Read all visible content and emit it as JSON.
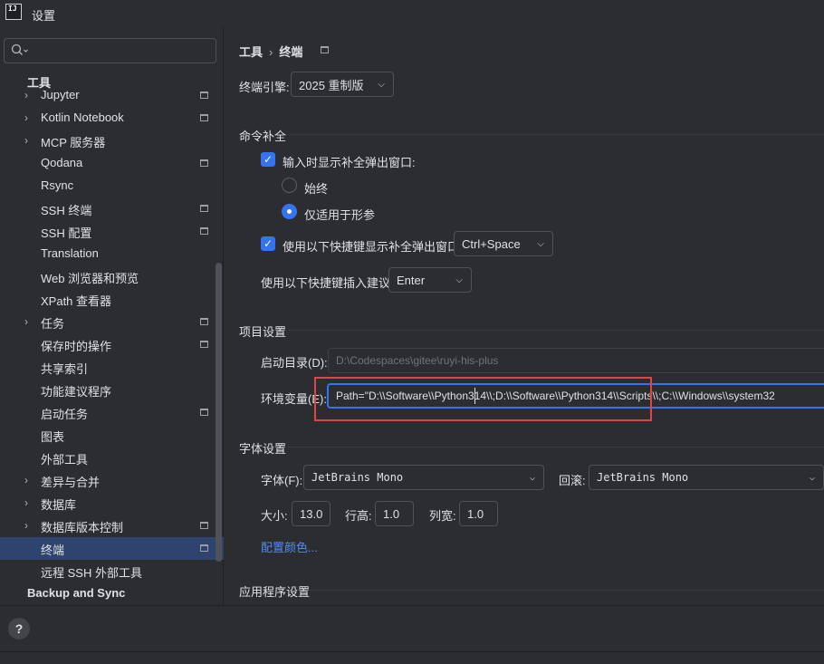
{
  "window": {
    "app_icon": "IJ",
    "title": "设置"
  },
  "search": {
    "value": "",
    "icon": "search-icon"
  },
  "sidebar": {
    "section_title": "工具",
    "items": [
      {
        "label": "Jupyter",
        "chevron": true,
        "doc": true
      },
      {
        "label": "Kotlin Notebook",
        "chevron": true,
        "doc": true
      },
      {
        "label": "MCP 服务器",
        "chevron": true,
        "doc": false
      },
      {
        "label": "Qodana",
        "chevron": false,
        "doc": true
      },
      {
        "label": "Rsync",
        "chevron": false,
        "doc": false
      },
      {
        "label": "SSH 终端",
        "chevron": false,
        "doc": true
      },
      {
        "label": "SSH 配置",
        "chevron": false,
        "doc": true
      },
      {
        "label": "Translation",
        "chevron": false,
        "doc": false
      },
      {
        "label": "Web 浏览器和预览",
        "chevron": false,
        "doc": false
      },
      {
        "label": "XPath 查看器",
        "chevron": false,
        "doc": false
      },
      {
        "label": "任务",
        "chevron": true,
        "doc": true
      },
      {
        "label": "保存时的操作",
        "chevron": false,
        "doc": true
      },
      {
        "label": "共享索引",
        "chevron": false,
        "doc": false
      },
      {
        "label": "功能建议程序",
        "chevron": false,
        "doc": false
      },
      {
        "label": "启动任务",
        "chevron": false,
        "doc": true
      },
      {
        "label": "图表",
        "chevron": false,
        "doc": false
      },
      {
        "label": "外部工具",
        "chevron": false,
        "doc": false
      },
      {
        "label": "差异与合并",
        "chevron": true,
        "doc": false
      },
      {
        "label": "数据库",
        "chevron": true,
        "doc": false
      },
      {
        "label": "数据库版本控制",
        "chevron": true,
        "doc": true
      },
      {
        "label": "终端",
        "chevron": false,
        "doc": true,
        "selected": true
      },
      {
        "label": "远程 SSH 外部工具",
        "chevron": false,
        "doc": false
      }
    ],
    "bottom_section": "Backup and Sync"
  },
  "breadcrumb": {
    "parent": "工具",
    "separator": "›",
    "current": "终端"
  },
  "engine": {
    "label": "终端引擎:",
    "value": "2025 重制版"
  },
  "completion": {
    "title": "命令补全",
    "show_popup_label": "输入时显示补全弹出窗口:",
    "always_label": "始终",
    "params_only_label": "仅适用于形参",
    "shortcut_popup_label": "使用以下快捷键显示补全弹出窗口:",
    "shortcut_popup_value": "Ctrl+Space",
    "insert_label": "使用以下快捷键插入建议:",
    "insert_value": "Enter"
  },
  "project": {
    "title": "项目设置",
    "start_dir_label": "启动目录(D):",
    "start_dir_placeholder": "D:\\Codespaces\\gitee\\ruyi-his-plus",
    "env_label": "环境变量(E):",
    "env_value": "Path=\"D:\\\\Software\\\\Python314\\\\;D:\\\\Software\\\\Python314\\\\Scripts\\\\;C:\\\\Windows\\\\system32"
  },
  "font": {
    "title": "字体设置",
    "font_label": "字体(F):",
    "font_value": "JetBrains Mono",
    "fallback_label": "回滚:",
    "fallback_value": "JetBrains Mono",
    "size_label": "大小:",
    "size_value": "13.0",
    "line_label": "行高:",
    "line_value": "1.0",
    "col_label": "列宽:",
    "col_value": "1.0",
    "colors_link": "配置颜色..."
  },
  "app": {
    "title": "应用程序设置"
  },
  "footer": {
    "help": "?"
  },
  "colors": {
    "accent": "#3574f0",
    "selection": "#2e436e",
    "highlight_box": "#e04545",
    "link": "#548af7"
  }
}
